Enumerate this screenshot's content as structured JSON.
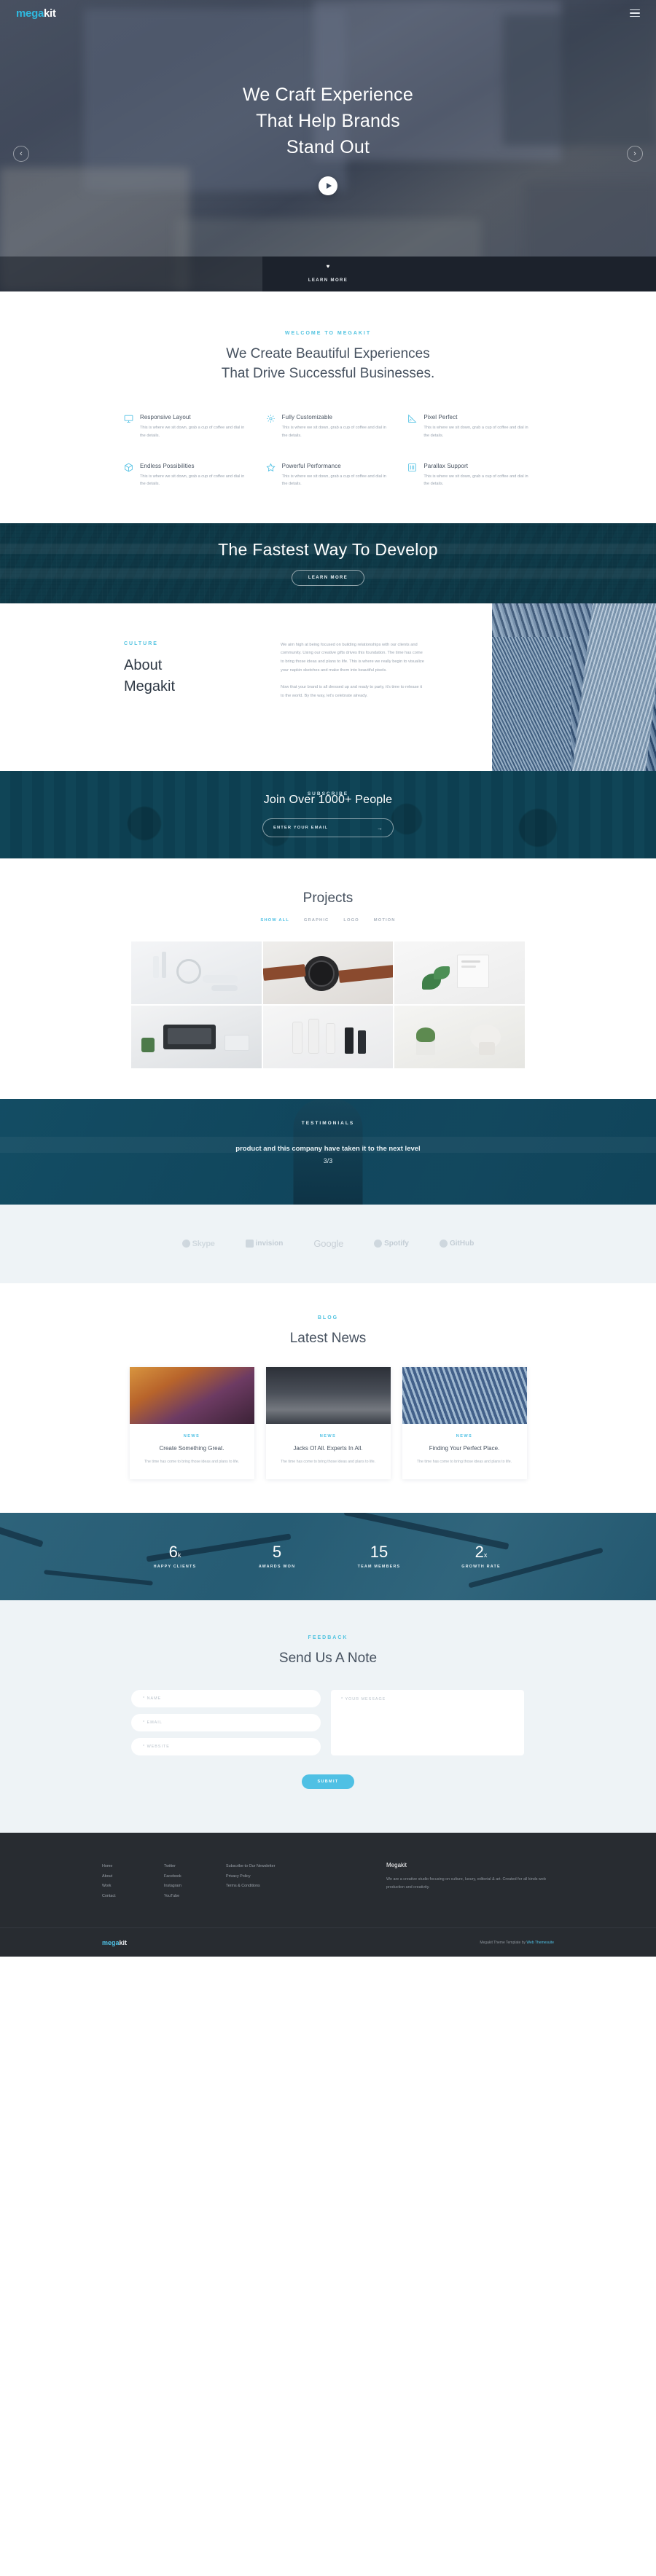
{
  "brand": {
    "part1": "mega",
    "part2": "kit"
  },
  "nav": {
    "menu_icon": "hamburger-icon"
  },
  "hero": {
    "title_line1": "We Craft Experience",
    "title_line2": "That Help Brands",
    "title_line3": "Stand Out",
    "play_label": "play-icon",
    "prev": "‹",
    "next": "›",
    "learn_more": "LEARN MORE",
    "heart": "♥"
  },
  "welcome": {
    "eyebrow": "WELCOME TO MEGAKIT",
    "title_line1": "We Create Beautiful Experiences",
    "title_line2": "That Drive Successful Businesses.",
    "features": [
      {
        "icon": "monitor-icon",
        "title": "Responsive Layout",
        "text": "This is where we sit down, grab a cup of coffee and dial in the details."
      },
      {
        "icon": "gear-icon",
        "title": "Fully Customizable",
        "text": "This is where we sit down, grab a cup of coffee and dial in the details."
      },
      {
        "icon": "ruler-icon",
        "title": "Pixel Perfect",
        "text": "This is where we sit down, grab a cup of coffee and dial in the details."
      },
      {
        "icon": "box-icon",
        "title": "Endless Possibilities",
        "text": "This is where we sit down, grab a cup of coffee and dial in the details."
      },
      {
        "icon": "star-icon",
        "title": "Powerful Performance",
        "text": "This is where we sit down, grab a cup of coffee and dial in the details."
      },
      {
        "icon": "sliders-icon",
        "title": "Parallax Support",
        "text": "This is where we sit down, grab a cup of coffee and dial in the details."
      }
    ]
  },
  "banner": {
    "title": "The Fastest Way To Develop",
    "button": "LEARN MORE"
  },
  "about": {
    "eyebrow": "CULTURE",
    "title_line1": "About",
    "title_line2": "Megakit",
    "paragraph1": "We aim high at being focused on building relationships with our clients and community. Using our creative gifts drives this foundation. The time has come to bring those ideas and plans to life. This is where we really begin to visualize your napkin sketches and make them into beautiful pixels.",
    "paragraph2": "Now that your brand is all dressed up and ready to party, it's time to release it to the world. By the way, let's celebrate already."
  },
  "subscribe": {
    "eyebrow": "SUBSCRIBE",
    "title": "Join Over 1000+ People",
    "input_placeholder": "ENTER YOUR EMAIL",
    "arrow": "→"
  },
  "projects": {
    "title": "Projects",
    "filters": [
      {
        "label": "SHOW ALL",
        "active": true
      },
      {
        "label": "GRAPHIC",
        "active": false
      },
      {
        "label": "LOGO",
        "active": false
      },
      {
        "label": "MOTION",
        "active": false
      }
    ]
  },
  "testimonials": {
    "eyebrow": "TESTIMONIALS",
    "quote": "product and this company have taken it to the next level",
    "counter": "3/3"
  },
  "clients": [
    {
      "name": "Skype",
      "icon": "skype-logo"
    },
    {
      "name": "invision",
      "icon": "invision-logo"
    },
    {
      "name": "Google",
      "icon": "google-logo"
    },
    {
      "name": "Spotify",
      "icon": "spotify-logo"
    },
    {
      "name": "GitHub",
      "icon": "github-logo"
    }
  ],
  "blog": {
    "eyebrow": "BLOG",
    "title": "Latest News",
    "posts": [
      {
        "tag": "NEWS",
        "title": "Create Something Great.",
        "excerpt": "The time has come to bring those ideas and plans to life."
      },
      {
        "tag": "NEWS",
        "title": "Jacks Of All. Experts In All.",
        "excerpt": "The time has come to bring those ideas and plans to life."
      },
      {
        "tag": "NEWS",
        "title": "Finding Your Perfect Place.",
        "excerpt": "The time has come to bring those ideas and plans to life."
      }
    ]
  },
  "stats": [
    {
      "number": "6",
      "suffix": "k",
      "label": "HAPPY CLIENTS"
    },
    {
      "number": "5",
      "suffix": "",
      "label": "AWARDS WON"
    },
    {
      "number": "15",
      "suffix": "",
      "label": "TEAM MEMBERS"
    },
    {
      "number": "2",
      "suffix": "x",
      "label": "GROWTH RATE"
    }
  ],
  "contact": {
    "eyebrow": "FEEDBACK",
    "title": "Send Us A Note",
    "name_placeholder": "* NAME",
    "email_placeholder": "* EMAIL",
    "website_placeholder": "* WEBSITE",
    "message_placeholder": "* YOUR MESSAGE",
    "submit": "SUBMIT"
  },
  "footer": {
    "col1": [
      "Home",
      "About",
      "Work",
      "Contact"
    ],
    "col2": [
      "Twitter",
      "Facebook",
      "Instagram",
      "YouTube"
    ],
    "col3": [
      "Subscribe to Our Newsletter",
      "Privacy Policy",
      "Terms & Conditions"
    ],
    "brand_title": "Megakit",
    "brand_text": "We are a creative studio focusing on culture, luxury, editorial & art. Created for all kinds web production and creativity.",
    "bottom_logo_a": "mega",
    "bottom_logo_b": "kit",
    "credit_pre": "Megakit Theme Template by ",
    "credit_link": "Web Themesuite"
  },
  "colors": {
    "accent": "#4fc0e4",
    "dark": "#282c31",
    "muted": "#9aa4b0"
  }
}
